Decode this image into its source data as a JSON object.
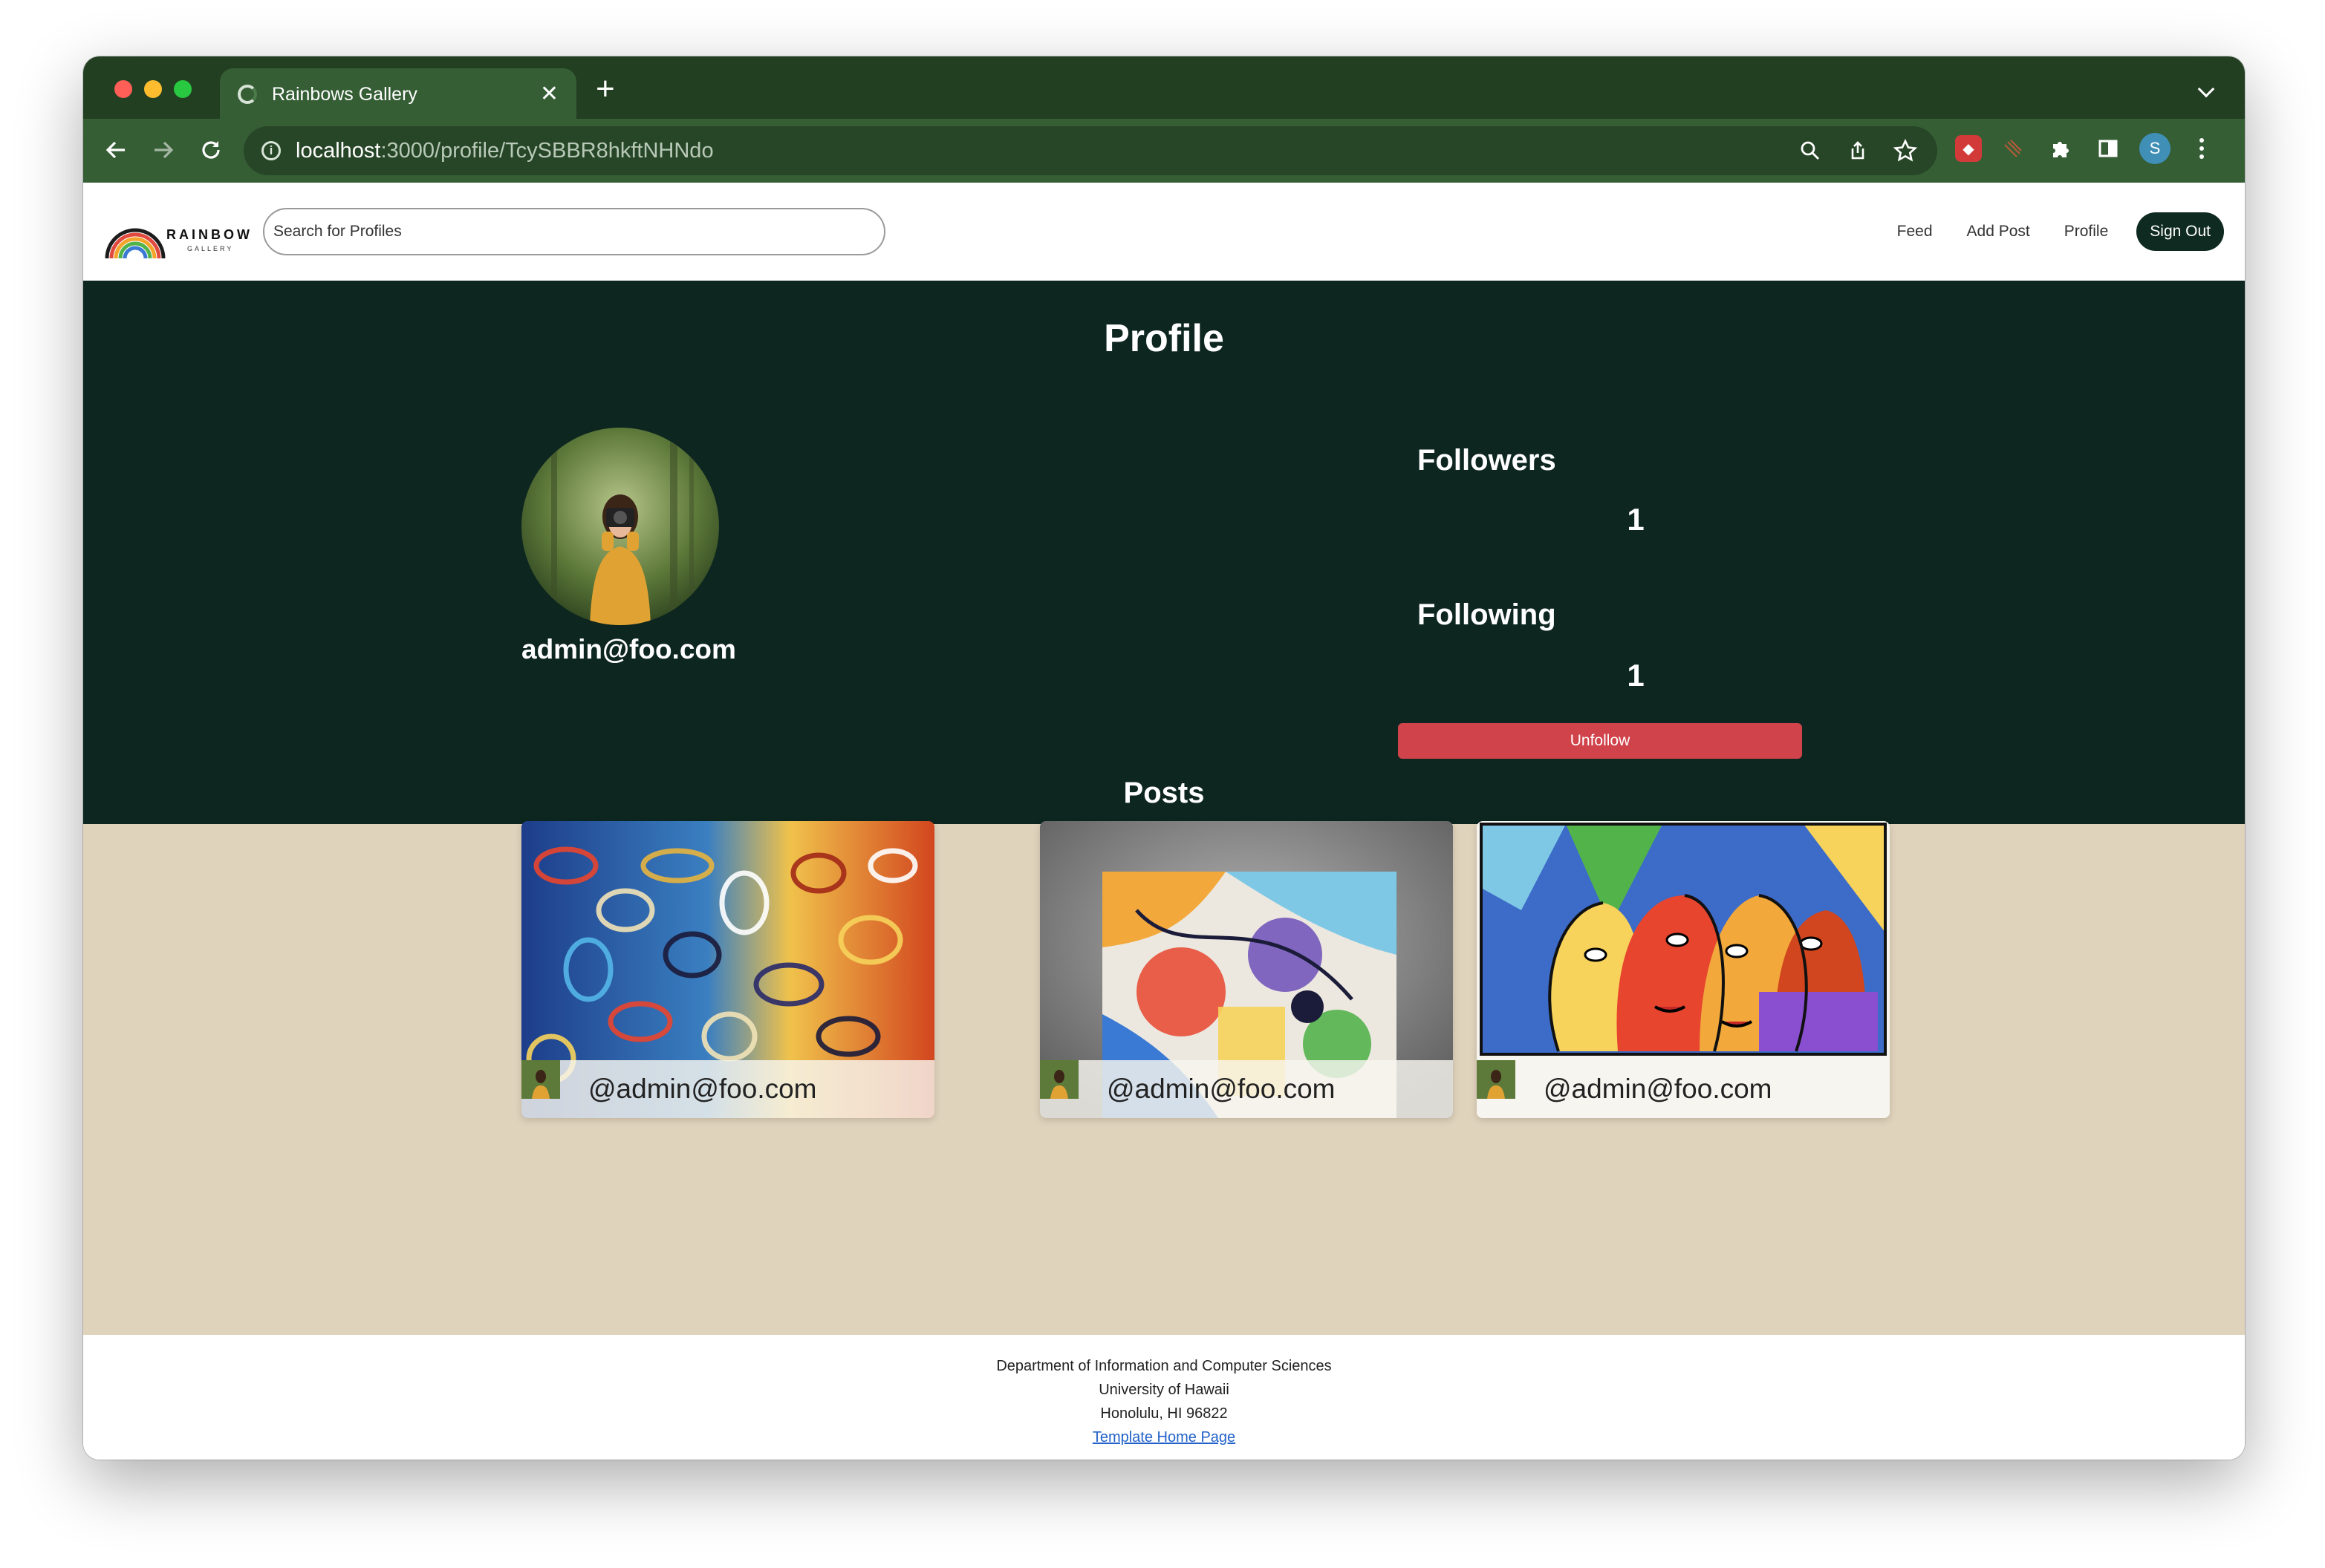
{
  "browser": {
    "tab_title": "Rainbows Gallery",
    "url_host": "localhost",
    "url_path": ":3000/profile/TcySBBR8hkftNHNdo",
    "profile_initial": "S"
  },
  "site": {
    "logo_word": "RAINBOW",
    "logo_sub": "GALLERY",
    "search_placeholder": "Search for Profiles",
    "nav": [
      "Feed",
      "Add Post",
      "Profile"
    ],
    "sign_out": "Sign Out"
  },
  "profile": {
    "title": "Profile",
    "email": "admin@foo.com",
    "followers_label": "Followers",
    "followers_count": "1",
    "following_label": "Following",
    "following_count": "1",
    "unfollow_label": "Unfollow",
    "posts_title": "Posts"
  },
  "posts": [
    {
      "user": "@admin@foo.com"
    },
    {
      "user": "@admin@foo.com"
    },
    {
      "user": "@admin@foo.com"
    }
  ],
  "footer": {
    "line1": "Department of Information and Computer Sciences",
    "line2": "University of Hawaii",
    "line3": "Honolulu, HI 96822",
    "link": "Template Home Page"
  },
  "colors": {
    "tabbar": "#233f22",
    "toolbar": "#355e35",
    "hero": "#0d2620",
    "beige": "#e0d3bc",
    "unfollow": "#d0434b",
    "signout": "#0f2a20"
  }
}
